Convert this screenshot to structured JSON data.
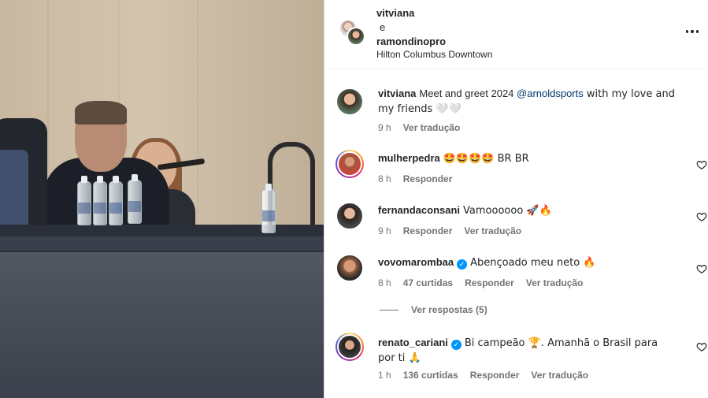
{
  "post": {
    "header": {
      "user1": "vitviana",
      "connector": "e",
      "user2": "ramondinopro",
      "location": "Hilton Columbus Downtown"
    },
    "caption": {
      "user": "vitviana",
      "text_before": "Meet and greet 2024 ",
      "mention": "@arnoldsports",
      "text_after": " with my love and my friends 🤍🤍",
      "time": "9 h",
      "translate": "Ver tradução"
    }
  },
  "comments": [
    {
      "user": "mulherpedra",
      "verified": false,
      "text": "🤩🤩🤩🤩 BR BR",
      "time": "8 h",
      "likes": "",
      "reply": "Responder",
      "translate": ""
    },
    {
      "user": "fernandaconsani",
      "verified": false,
      "text": "Vamoooooo 🚀🔥",
      "time": "9 h",
      "likes": "",
      "reply": "Responder",
      "translate": "Ver tradução"
    },
    {
      "user": "vovomarombaa",
      "verified": true,
      "text": "Abençoado meu neto 🔥",
      "time": "8 h",
      "likes": "47 curtidas",
      "reply": "Responder",
      "translate": "Ver tradução"
    },
    {
      "user": "renato_cariani",
      "verified": true,
      "text": "Bi campeão 🏆. Amanhã o Brasil para por ti 🙏",
      "time": "1 h",
      "likes": "136 curtidas",
      "reply": "Responder",
      "translate": "Ver tradução"
    }
  ],
  "view_replies": "Ver respostas (5)",
  "icons": {
    "more": "more-horizontal-icon",
    "like": "heart-outline-icon",
    "verified": "verified-badge-icon"
  },
  "colors": {
    "text": "#262626",
    "secondary": "#737373",
    "mention": "#00376b",
    "verified": "#0095f6"
  }
}
